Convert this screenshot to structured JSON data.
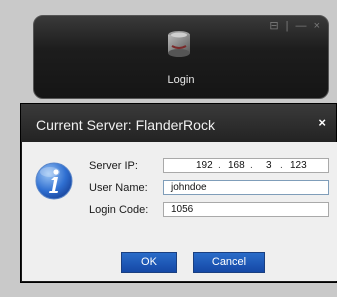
{
  "launcher": {
    "label": "Login",
    "window_controls": "⊟ | — ×"
  },
  "dialog": {
    "title": "Current Server: FlanderRock",
    "close_glyph": "×",
    "server_ip_label": "Server IP:",
    "user_name_label": "User Name:",
    "login_code_label": "Login Code:",
    "server_ip": [
      "192",
      "168",
      "3",
      "123"
    ],
    "user_name": "johndoe",
    "login_code": "1056",
    "ok_label": "OK",
    "cancel_label": "Cancel"
  },
  "icons": {
    "launcher": "server-disk-icon",
    "info": "info-icon"
  },
  "colors": {
    "dialog_bar": "#232323",
    "button": "#1f5bbf",
    "field_border_focus": "#7f9db9"
  }
}
